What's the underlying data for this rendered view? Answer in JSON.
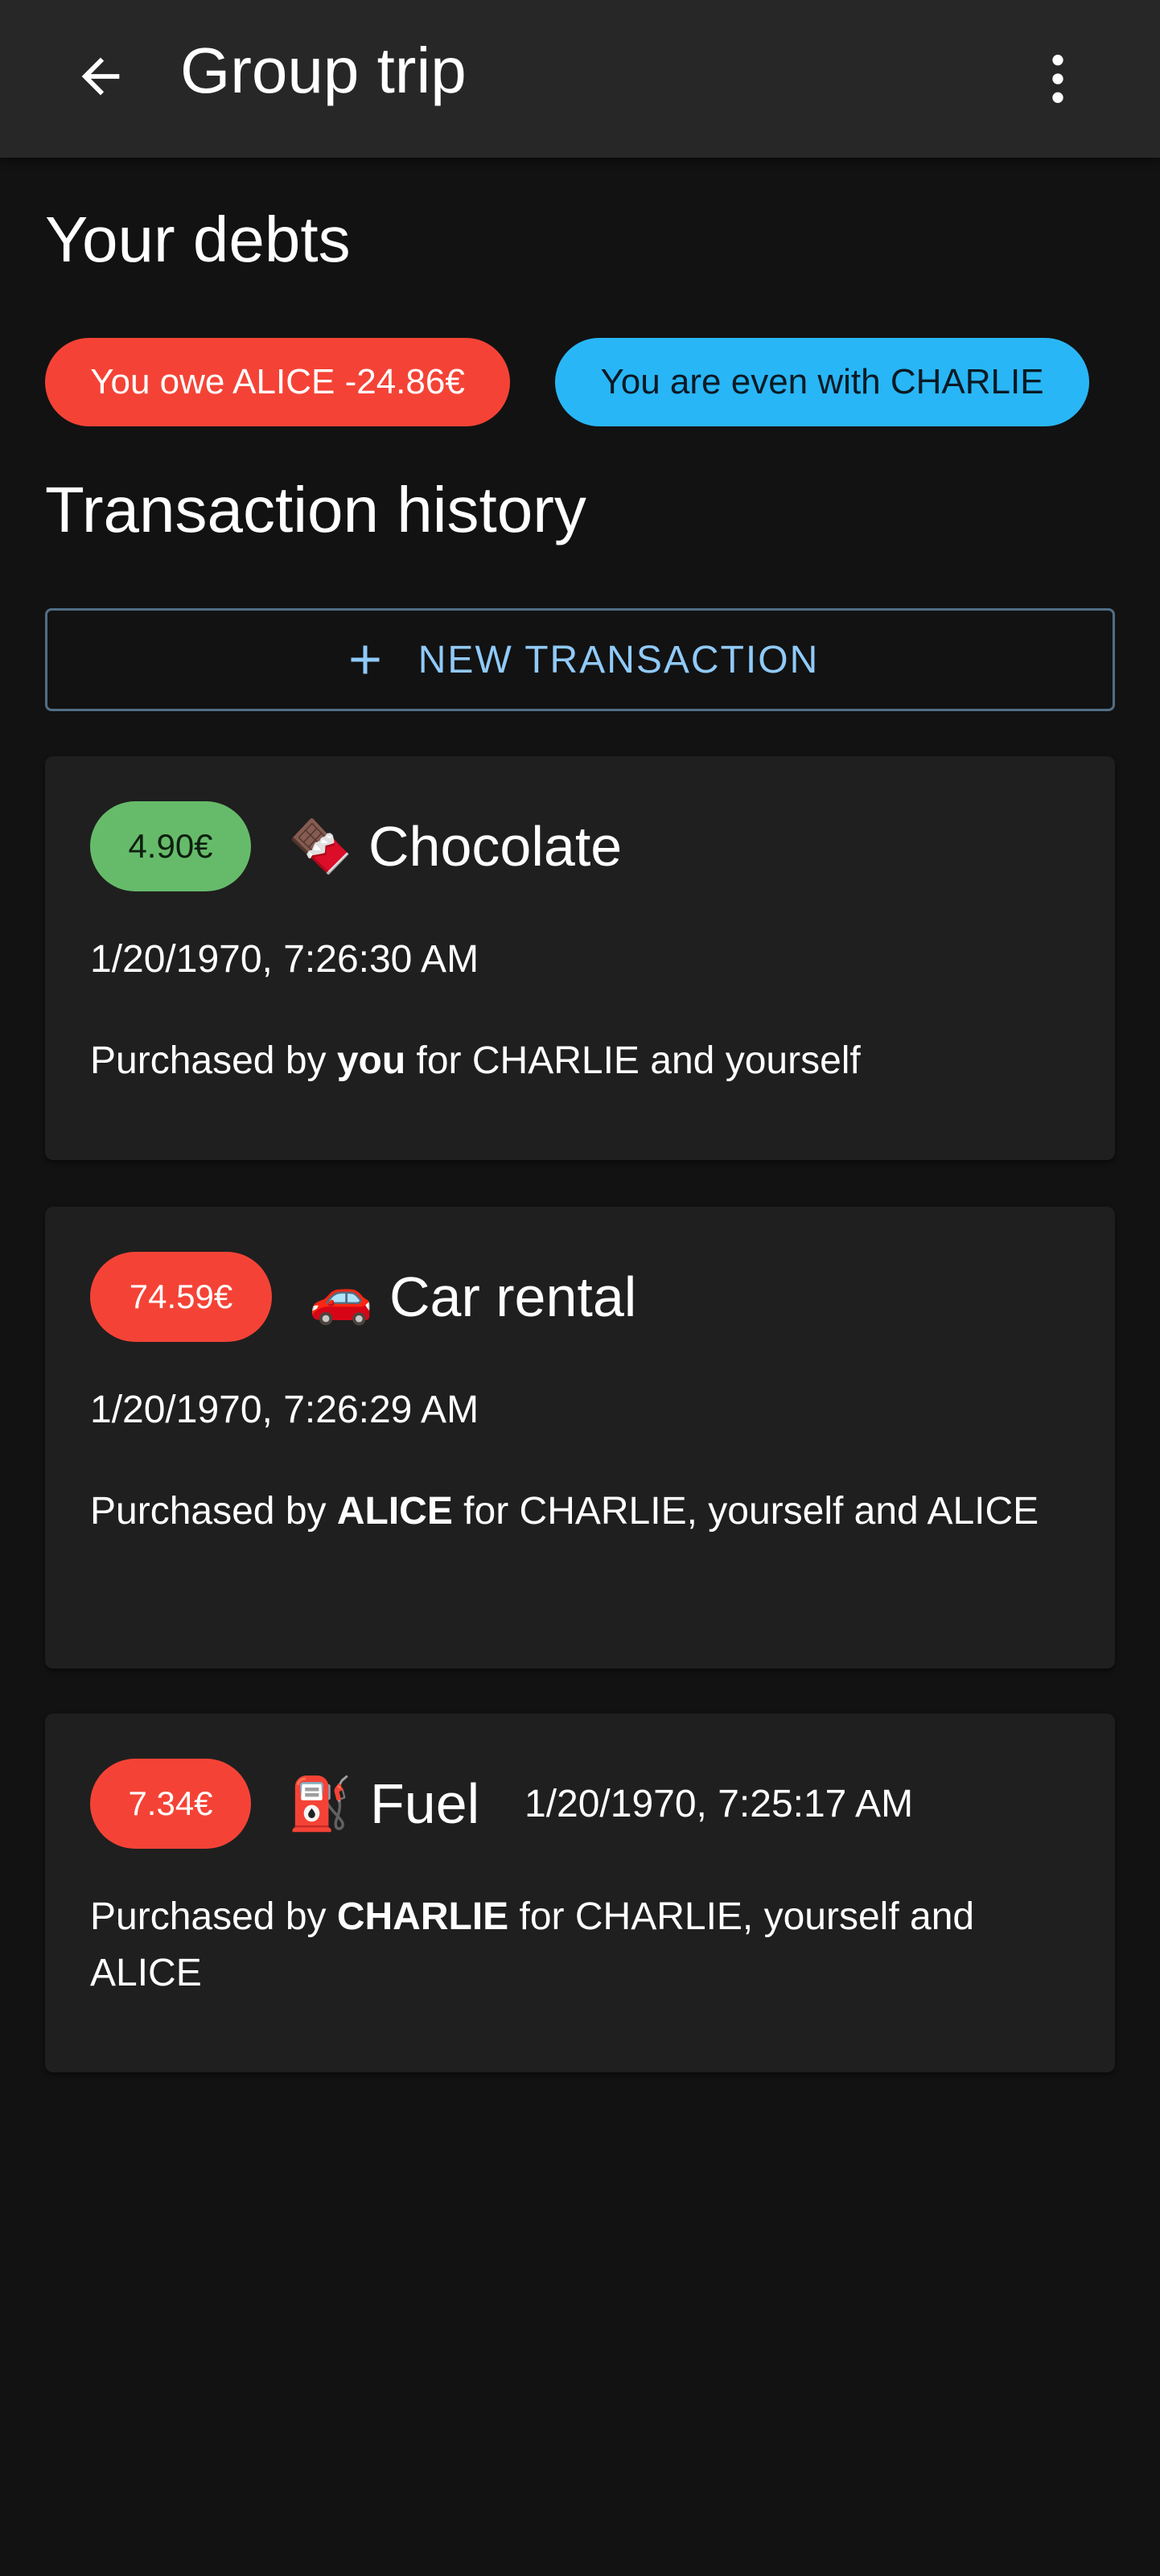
{
  "appbar": {
    "title": "Group trip",
    "back_icon": "arrow-left-icon",
    "more_icon": "more-vertical-icon"
  },
  "debts": {
    "title": "Your debts",
    "chips": [
      {
        "label": "You owe ALICE -24.86€",
        "color": "#f44336"
      },
      {
        "label": "You are even with CHARLIE",
        "color": "#29b6f6"
      }
    ]
  },
  "history": {
    "title": "Transaction history",
    "new_button_label": "NEW TRANSACTION",
    "new_button_icon": "plus-icon"
  },
  "transactions": [
    {
      "amount": "4.90€",
      "amount_color": "#66bb6a",
      "emoji": "🍫",
      "title": "Chocolate",
      "date": "1/20/1970, 7:26:30 AM",
      "desc_prefix": "Purchased by ",
      "buyer": "you",
      "desc_suffix": " for CHARLIE and yourself"
    },
    {
      "amount": "74.59€",
      "amount_color": "#f44336",
      "emoji": "🚗",
      "title": "Car rental",
      "date": "1/20/1970, 7:26:29 AM",
      "desc_prefix": "Purchased by ",
      "buyer": "ALICE",
      "desc_suffix": " for CHARLIE, yourself and ALICE"
    },
    {
      "amount": "7.34€",
      "amount_color": "#f44336",
      "emoji": "⛽",
      "title": "Fuel",
      "date": "1/20/1970, 7:25:17 AM",
      "desc_prefix": "Purchased by ",
      "buyer": "CHARLIE",
      "desc_suffix": " for CHARLIE, yourself and ALICE"
    }
  ]
}
